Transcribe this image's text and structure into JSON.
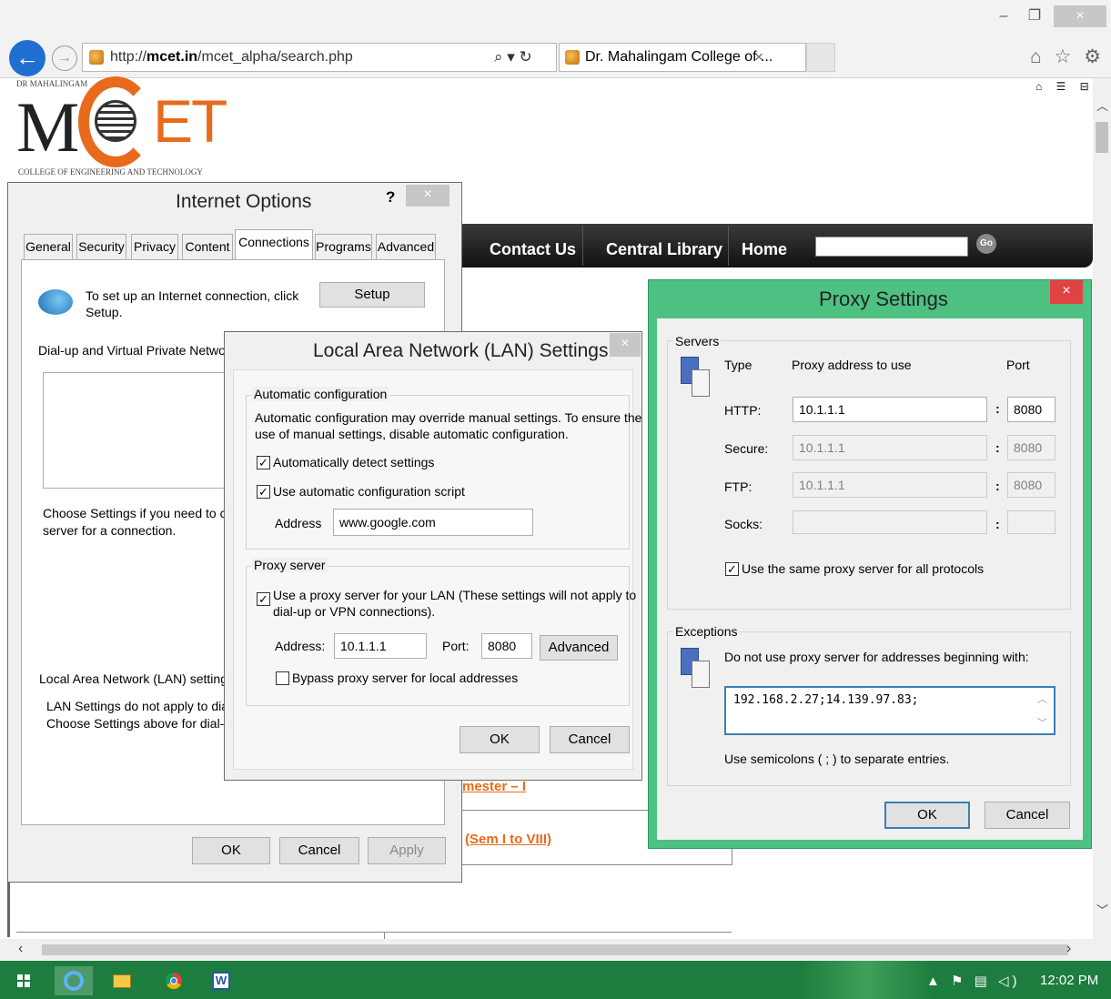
{
  "browser": {
    "url_prefix": "http://",
    "url_domain": "mcet.in",
    "url_path": "/mcet_alpha/search.php",
    "search_glyph": "⌕ ▾ ↻",
    "tab_title": "Dr. Mahalingam College of ...",
    "tab_close": "×",
    "min": "–",
    "restore": "❐",
    "close": "×",
    "toolbar_icons": "⌂ ☆ ⚙",
    "page_icons": "⌂ ☰ ⊟"
  },
  "logo": {
    "top_text": "DR MAHALINGAM",
    "letters_left": "M",
    "letters_right": "ET",
    "bottom_text": "COLLEGE OF ENGINEERING AND TECHNOLOGY"
  },
  "site": {
    "nav": [
      "Contact Us",
      "Central Library",
      "Home"
    ],
    "go": "Go",
    "link_semester": "mester  –  I",
    "link_sem_range": "(Sem  I  to  VIII)"
  },
  "internet_options": {
    "title": "Internet Options",
    "help": "?",
    "close": "×",
    "tabs": [
      "General",
      "Security",
      "Privacy",
      "Content",
      "Connections",
      "Programs",
      "Advanced"
    ],
    "setup_text_1": "To set up an Internet connection, click",
    "setup_text_2": "Setup.",
    "setup_button": "Setup",
    "dialup_label": "Dial-up and Virtual Private Network s",
    "choose_text_1": "Choose Settings if you need to con",
    "choose_text_2": "server for a connection.",
    "lan_section": "Local Area Network (LAN) settings",
    "lan_text_1": "LAN Settings do not apply to dial-u",
    "lan_text_2": "Choose Settings above for dial-up",
    "ok": "OK",
    "cancel": "Cancel",
    "apply": "Apply"
  },
  "lan": {
    "title": "Local Area Network (LAN) Settings",
    "close": "×",
    "auto_group": "Automatic configuration",
    "auto_desc_1": "Automatic configuration may override manual settings.  To ensure the",
    "auto_desc_2": "use of manual settings, disable automatic configuration.",
    "auto_detect": "Automatically detect settings",
    "use_script": "Use automatic configuration script",
    "address_label": "Address",
    "address_value": "www.google.com",
    "proxy_group": "Proxy server",
    "use_proxy_1": "Use a proxy server for your LAN (These settings will not apply to",
    "use_proxy_2": "dial-up or VPN connections).",
    "proxy_address_label": "Address:",
    "proxy_address_value": "10.1.1.1",
    "port_label": "Port:",
    "port_value": "8080",
    "advanced": "Advanced",
    "bypass": "Bypass proxy server for local addresses",
    "ok": "OK",
    "cancel": "Cancel",
    "check": "✓"
  },
  "proxy": {
    "title": "Proxy Settings",
    "close": "×",
    "servers_group": "Servers",
    "col_type": "Type",
    "col_address": "Proxy address to use",
    "col_port": "Port",
    "rows": [
      {
        "type": "HTTP:",
        "address": "10.1.1.1",
        "port": "8080"
      },
      {
        "type": "Secure:",
        "address": "10.1.1.1",
        "port": "8080"
      },
      {
        "type": "FTP:",
        "address": "10.1.1.1",
        "port": "8080"
      },
      {
        "type": "Socks:",
        "address": "",
        "port": ""
      }
    ],
    "colon": ":",
    "same_proxy": "Use the same proxy server for all protocols",
    "exceptions_group": "Exceptions",
    "do_not_use": "Do not use proxy server for addresses beginning with:",
    "exceptions_value": "192.168.2.27;14.139.97.83;",
    "semicolon_hint": "Use semicolons ( ; ) to separate entries.",
    "ok": "OK",
    "cancel": "Cancel",
    "check": "✓"
  },
  "taskbar": {
    "clock": "12:02 PM",
    "tray": "▲ ⚑ ▤ ◁)"
  }
}
